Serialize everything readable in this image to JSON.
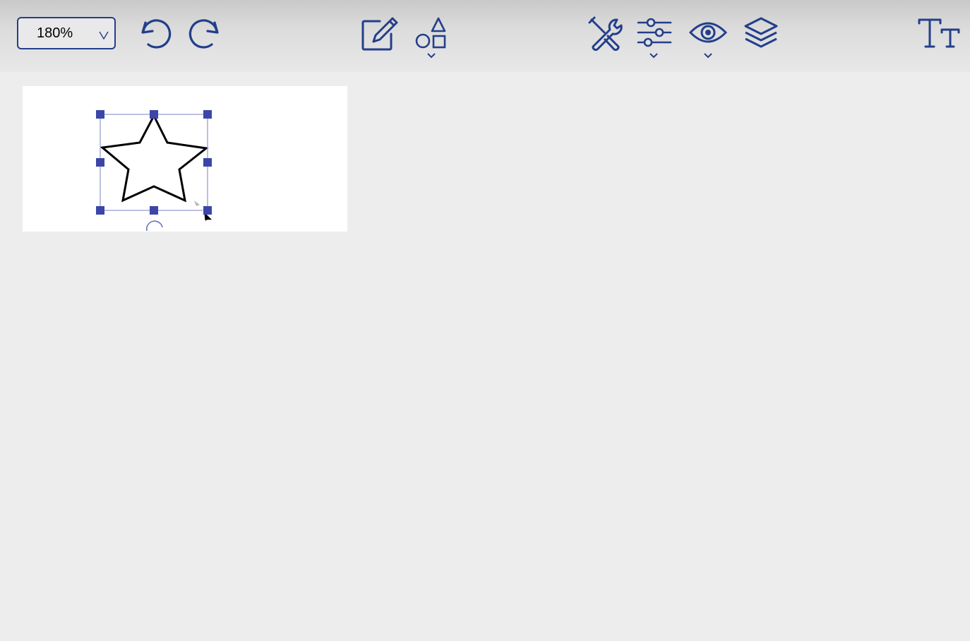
{
  "app": {
    "accent_color": "#233f8b",
    "handle_color": "#3b46a8",
    "canvas_bg": "#ededed"
  },
  "toolbar": {
    "zoom": {
      "value": "180%",
      "icon": "chevron-down-icon"
    },
    "buttons": [
      {
        "name": "undo",
        "icon": "undo-icon"
      },
      {
        "name": "redo",
        "icon": "redo-icon"
      },
      {
        "name": "edit",
        "icon": "pencil-square-icon"
      },
      {
        "name": "shapes",
        "icon": "shapes-icon",
        "has_dropdown": true
      },
      {
        "name": "tools",
        "icon": "tools-icon"
      },
      {
        "name": "adjust",
        "icon": "sliders-icon",
        "has_dropdown": true
      },
      {
        "name": "view",
        "icon": "eye-icon",
        "has_dropdown": true
      },
      {
        "name": "layers",
        "icon": "layers-icon"
      },
      {
        "name": "text",
        "icon": "text-size-icon"
      }
    ]
  },
  "document": {
    "selected_shape": {
      "type": "star",
      "stroke_color": "#000000",
      "fill": "none",
      "selected": true
    }
  }
}
